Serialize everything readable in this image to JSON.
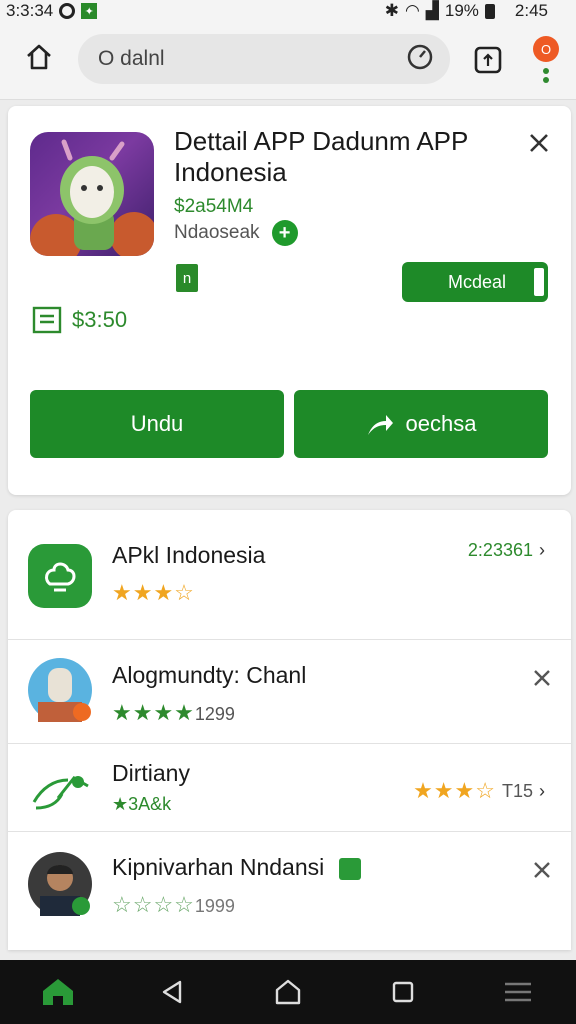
{
  "status": {
    "left_time": "3:3:34",
    "battery": "19%",
    "clock": "2:45"
  },
  "browser": {
    "url_text": "O dalnl",
    "menu_badge": "O"
  },
  "detail": {
    "title": "Dettail APP Dadunm APP Indonesia",
    "price_sub": "$2a54M4",
    "developer": "Ndaoseak",
    "badge": "n",
    "modal_button": "Mcdeal",
    "price": "$3:50",
    "unduh_button": "Undu",
    "share_button": "oechsa",
    "colors": {
      "accent": "#1e8a28",
      "price": "#2d8a2d"
    }
  },
  "list": {
    "items": [
      {
        "title": "APkl Indonesia",
        "stars": "★★★☆",
        "right_text": "2:23361",
        "icon": "app-icon",
        "action": "chevron"
      },
      {
        "title": "Alogmundty: Chanl",
        "stars": "★★★★",
        "sub": "1299",
        "icon": "avatar",
        "action": "close"
      },
      {
        "title": "Dirtiany",
        "sub": "★3A&k",
        "stars": "★★★☆",
        "right_text": "T15",
        "icon": "leaf-logo",
        "action": "chevron"
      },
      {
        "title": "Kipnivarhan Nndansi",
        "stars": "☆☆☆☆",
        "sub": "1999",
        "icon": "avatar",
        "action": "close"
      }
    ]
  }
}
